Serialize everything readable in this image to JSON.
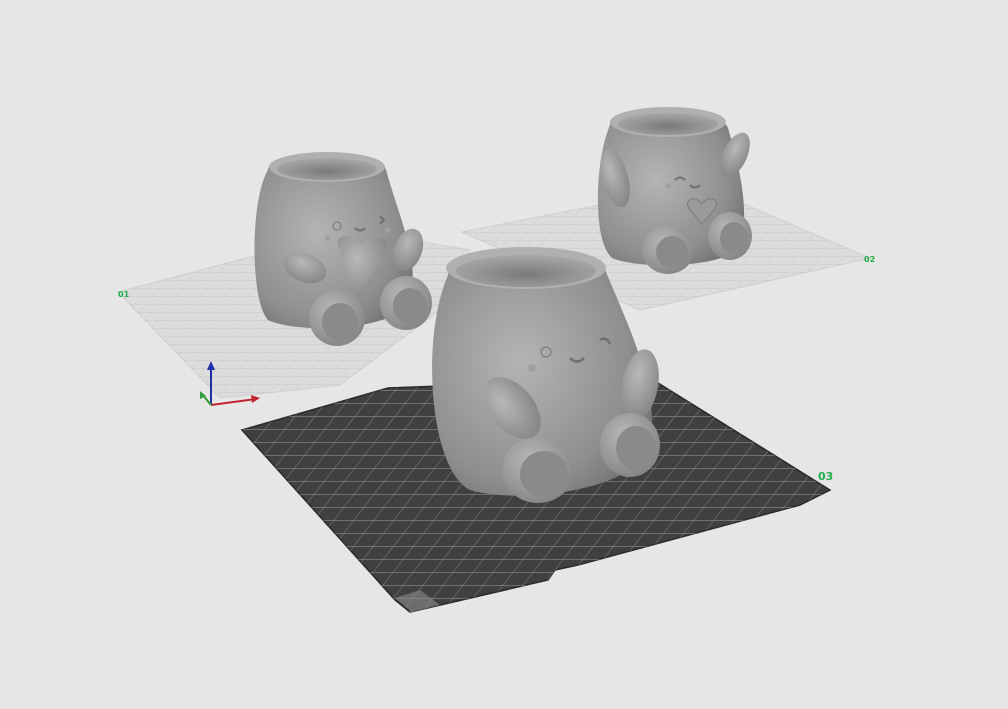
{
  "viewport": {
    "background": "#e6e6e6",
    "active_plate_color": "#404040",
    "inactive_plate_color": "#d8d8d8",
    "model_color": "#9a9a9a",
    "label_color": "#1fae4b"
  },
  "plates": [
    {
      "label": "01",
      "state": "inactive"
    },
    {
      "label": "02",
      "state": "inactive"
    },
    {
      "label": "03",
      "state": "active"
    }
  ],
  "models": [
    {
      "name": "planter-bear-holding-heart",
      "plate": "01"
    },
    {
      "name": "planter-bear-waving",
      "plate": "02"
    },
    {
      "name": "planter-bear-arms-down",
      "plate": "03"
    }
  ],
  "axes": {
    "x_color": "#c0262e",
    "y_color": "#2d9e3a",
    "z_color": "#1f2fa8"
  }
}
